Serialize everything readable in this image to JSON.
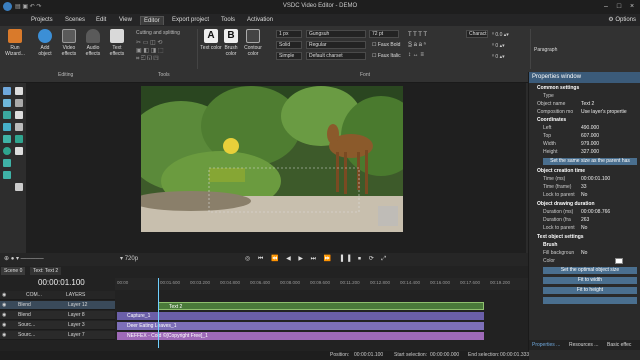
{
  "window": {
    "title": "VSDC Video Editor - DEMO"
  },
  "menu": {
    "items": [
      "Projects",
      "Scenes",
      "Edit",
      "View",
      "Editor",
      "Export project",
      "Tools",
      "Activation"
    ],
    "options_label": "Options"
  },
  "ribbon": {
    "run_wizard": "Run Wizard...",
    "add_object": "Add object",
    "video_effects": "Video effects",
    "audio_effects": "Audio effects",
    "text_effects": "Text effects",
    "editing_label": "Editing",
    "cutting_label": "Cutting and splitting",
    "tools_label": "Tools",
    "text_color": "Text color",
    "brush_color": "Brush color",
    "contour_color": "Contour color",
    "line_width": "1 px",
    "line_style": "Solid",
    "line_type": "Simple",
    "font_name": "Gungsuh",
    "font_style": "Regular",
    "charset": "Default charset",
    "font_size": "72 pt",
    "faux_bold": "Faux Bold",
    "faux_italic": "Faux Italic",
    "character": "Charact",
    "font_label": "Font",
    "paragraph_label": "Paragraph"
  },
  "properties": {
    "title": "Properties window",
    "common_settings": "Common settings",
    "type_label": "Type",
    "object_name_key": "Object name",
    "object_name_val": "Text 2",
    "composition_key": "Composition mo",
    "composition_val": "Use layer's propertie",
    "coordinates": "Coordinates",
    "left_key": "Left",
    "left_val": "490.000",
    "top_key": "Top",
    "top_val": "607.000",
    "width_key": "Width",
    "width_val": "979.000",
    "height_key": "Height",
    "height_val": "327.000",
    "same_size_btn": "Set the same size as the parent has",
    "creation_time": "Object creation time",
    "time_ms_key": "Time (ms)",
    "time_ms_val": "00:00:01.100",
    "time_frame_key": "Time (frame)",
    "time_frame_val": "33",
    "lock_parent_key": "Lock to parent",
    "lock_parent_val": "No",
    "drawing_duration": "Object drawing duration",
    "dur_ms_key": "Duration (ms)",
    "dur_ms_val": "00:00:08.766",
    "dur_frame_key": "Duration (fra",
    "dur_frame_val": "263",
    "lock_parent2_key": "Lock to parent",
    "lock_parent2_val": "No",
    "text_settings": "Text object settings",
    "brush": "Brush",
    "fill_bg_key": "Fill backgroun",
    "fill_bg_val": "No",
    "color_key": "Color",
    "optimal_btn": "Set the optimal object size",
    "fit_width_btn": "Fit to width",
    "fit_height_btn": "Fit to height",
    "tabs": [
      "Properties ...",
      "Resources ...",
      "Basic effec"
    ]
  },
  "transport": {
    "zoom": "720p"
  },
  "timeline": {
    "tabs": [
      "Scene 0",
      "Text: Text 2"
    ],
    "time": "00:00:01.100",
    "com_label": "COM...",
    "layers_label": "LAYERS",
    "ruler": [
      "00:00",
      "00:01.600",
      "00:03.200",
      "00:04.800",
      "00:06.400",
      "00:08.000",
      "00:09.600",
      "00:11.200",
      "00:12.800",
      "00:14.400",
      "00:16.000",
      "00:17.600",
      "00:19.200",
      "00:20.800"
    ],
    "tracks": [
      {
        "mode": "Blend",
        "layer": "Layer 12"
      },
      {
        "mode": "Blend",
        "layer": "Layer 8"
      },
      {
        "mode": "Sourc...",
        "layer": "Layer 3"
      },
      {
        "mode": "Sourc...",
        "layer": "Layer 7"
      }
    ],
    "clips": {
      "text": "Text 2",
      "capture": "Capture_1",
      "deer": "Deer Eating Leaves_1",
      "music": "NEFFEX - Cold ©[Copyright Free]_1"
    }
  },
  "status": {
    "position_label": "Position:",
    "position_val": "00:00:01.100",
    "start_label": "Start selection:",
    "start_val": "00:00:00.000",
    "end_label": "End selection:",
    "end_val": "00:00:01.333"
  },
  "colors": {
    "accent": "#3b5b7a",
    "selection": "#4a6f8f",
    "clip_text": "#4a7a3a",
    "clip_video": "#6b5fa8",
    "clip_audio": "#9e6ab8"
  }
}
